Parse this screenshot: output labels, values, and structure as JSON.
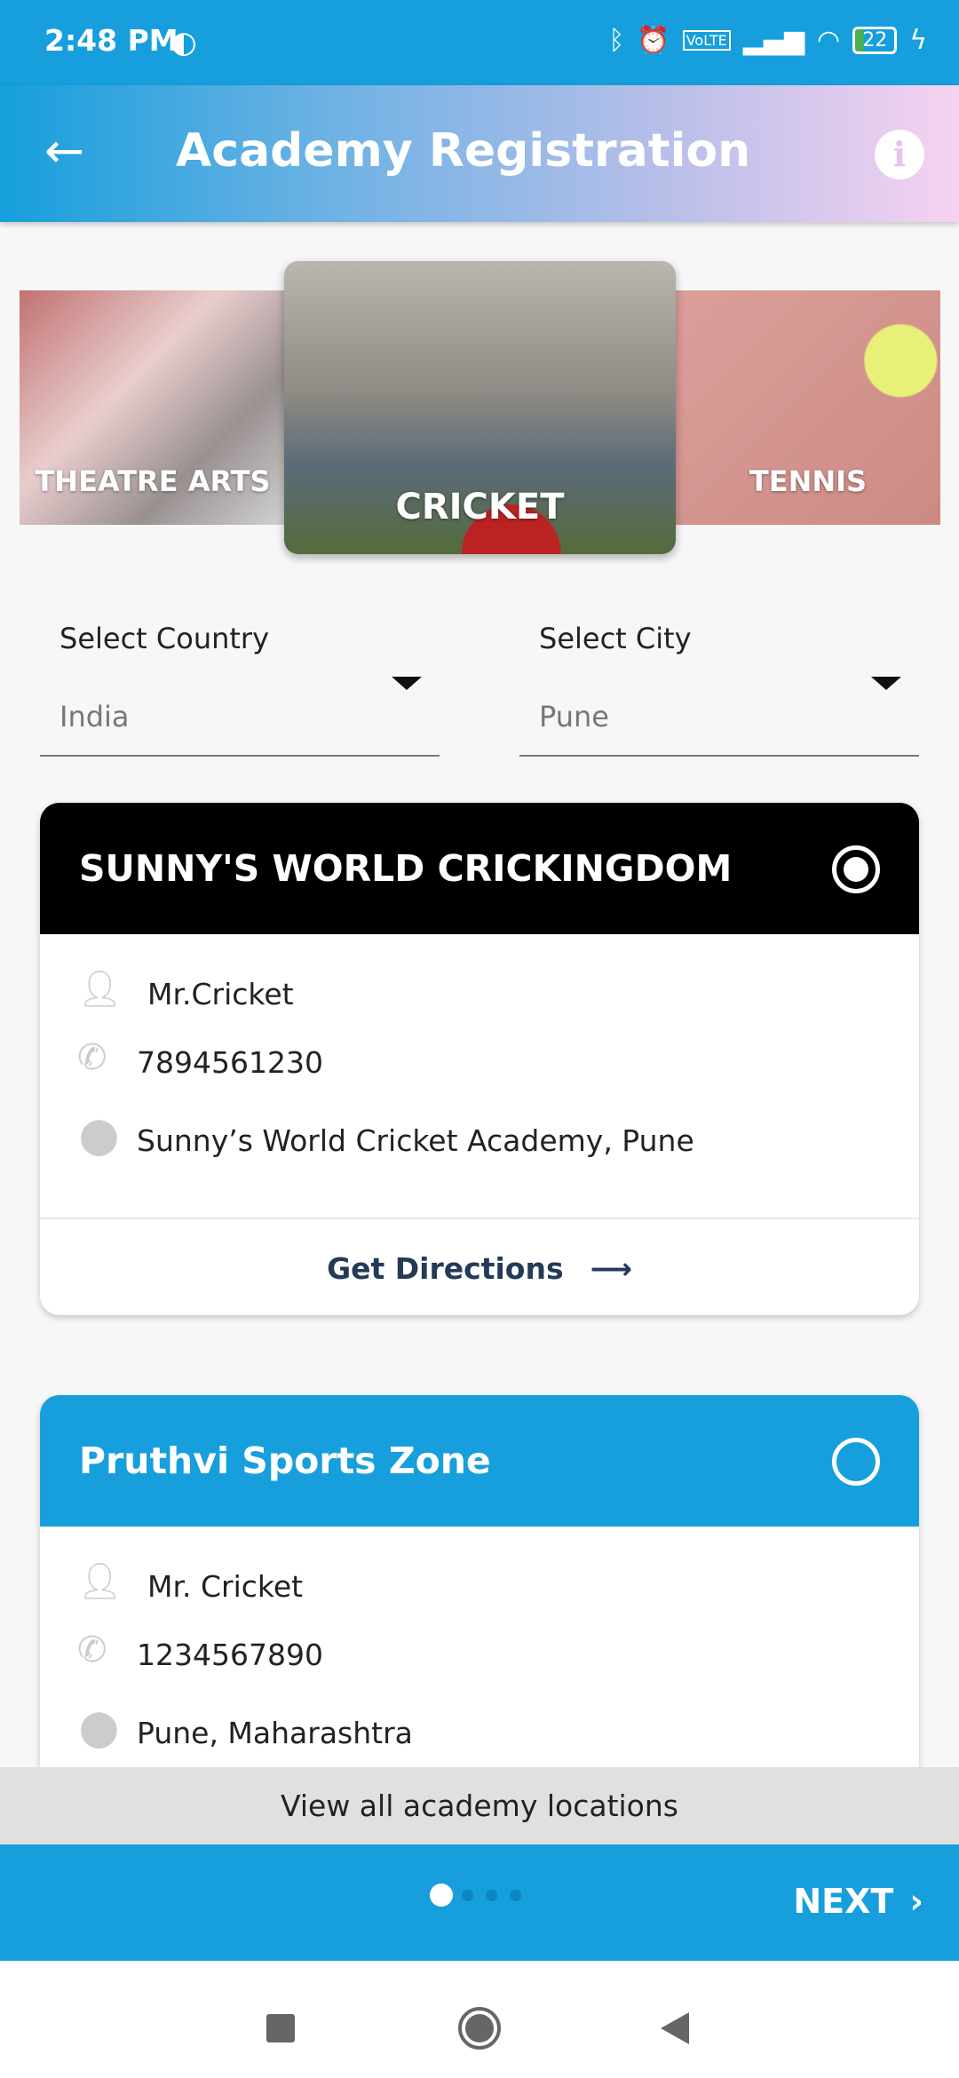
{
  "status_bar": {
    "time": "2:48 PM",
    "battery": "22"
  },
  "header": {
    "title": "Academy Registration"
  },
  "carousel": [
    {
      "label": "THEATRE ARTS"
    },
    {
      "label": "CRICKET",
      "selected": true
    },
    {
      "label": "TENNIS"
    }
  ],
  "filters": {
    "country": {
      "label": "Select Country",
      "value": "India"
    },
    "city": {
      "label": "Select City",
      "value": "Pune"
    }
  },
  "academies": [
    {
      "name": "SUNNY'S WORLD CRICKINGDOM",
      "contact": "Mr.Cricket",
      "phone": "7894561230",
      "address": "Sunny’s World Cricket Academy, Pune",
      "directions": "Get Directions",
      "selected": true,
      "header_color": "#000000"
    },
    {
      "name": "Pruthvi Sports Zone",
      "contact": "Mr. Cricket",
      "phone": "1234567890",
      "address": "Pune, Maharashtra",
      "selected": false,
      "header_color": "#169fdc"
    }
  ],
  "view_all": "View all academy locations",
  "footer": {
    "next_label": "NEXT",
    "page_index": 1,
    "page_count": 4
  },
  "colors": {
    "primary": "#169fdc",
    "directions": "#233a58"
  }
}
